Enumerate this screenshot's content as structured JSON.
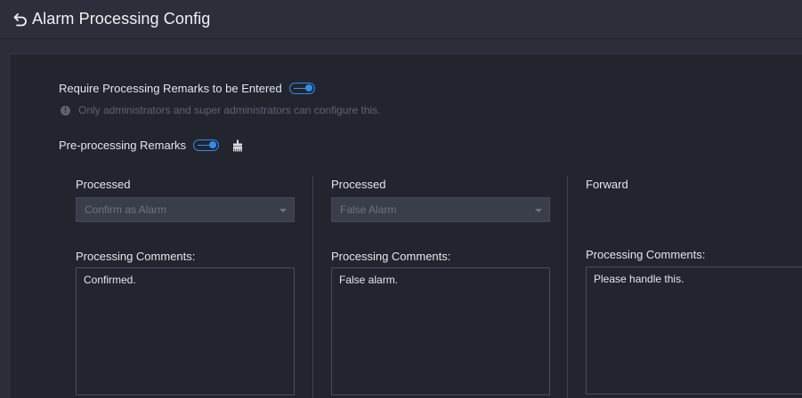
{
  "header": {
    "title": "Alarm Processing Config"
  },
  "settings": {
    "require_remarks_label": "Require Processing Remarks to be Entered",
    "require_remarks_enabled": true,
    "hint_text": "Only administrators and super administrators can configure this.",
    "preprocessing_label": "Pre-processing Remarks",
    "preprocessing_enabled": true
  },
  "columns": [
    {
      "label": "Processed",
      "select_value": "Confirm as Alarm",
      "comments_label": "Processing Comments:",
      "comments_value": "Confirmed."
    },
    {
      "label": "Processed",
      "select_value": "False Alarm",
      "comments_label": "Processing Comments:",
      "comments_value": "False alarm."
    },
    {
      "label": "Forward",
      "comments_label": "Processing Comments:",
      "comments_value": "Please handle this."
    }
  ],
  "colors": {
    "accent": "#2f8ef0",
    "background": "#2b2e38",
    "panel": "#22252e"
  },
  "icons": {
    "back": "back-arrow-icon",
    "info": "info-icon",
    "clear": "clear-broom-icon"
  }
}
